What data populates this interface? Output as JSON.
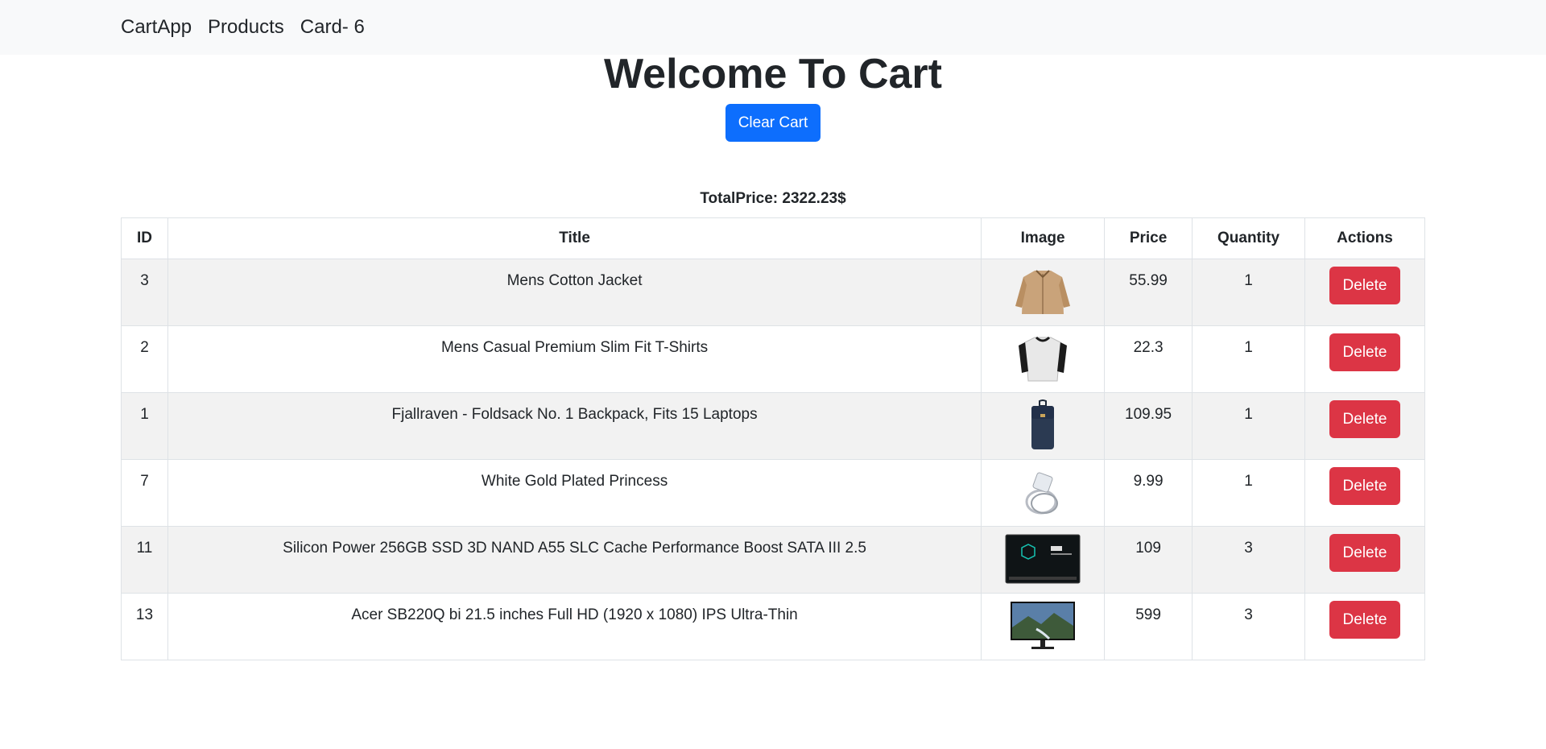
{
  "nav": {
    "brand": "CartApp",
    "products": "Products",
    "card": "Card- 6"
  },
  "main": {
    "title": "Welcome To Cart",
    "clear_button": "Clear Cart",
    "total_text": "TotalPrice: 2322.23$"
  },
  "table": {
    "headers": {
      "id": "ID",
      "title": "Title",
      "image": "Image",
      "price": "Price",
      "quantity": "Quantity",
      "actions": "Actions"
    },
    "rows": [
      {
        "id": "3",
        "title": "Mens Cotton Jacket",
        "image": "jacket-image",
        "price": "55.99",
        "quantity": "1",
        "action": "Delete"
      },
      {
        "id": "2",
        "title": "Mens Casual Premium Slim Fit T-Shirts",
        "image": "tshirt-image",
        "price": "22.3",
        "quantity": "1",
        "action": "Delete"
      },
      {
        "id": "1",
        "title": "Fjallraven - Foldsack No. 1 Backpack, Fits 15 Laptops",
        "image": "backpack-image",
        "price": "109.95",
        "quantity": "1",
        "action": "Delete"
      },
      {
        "id": "7",
        "title": "White Gold Plated Princess",
        "image": "ring-image",
        "price": "9.99",
        "quantity": "1",
        "action": "Delete"
      },
      {
        "id": "11",
        "title": "Silicon Power 256GB SSD 3D NAND A55 SLC Cache Performance Boost SATA III 2.5",
        "image": "ssd-image",
        "price": "109",
        "quantity": "3",
        "action": "Delete"
      },
      {
        "id": "13",
        "title": "Acer SB220Q bi 21.5 inches Full HD (1920 x 1080) IPS Ultra-Thin",
        "image": "monitor-image",
        "price": "599",
        "quantity": "3",
        "action": "Delete"
      }
    ]
  },
  "colors": {
    "navbar_bg": "#f8f9fa",
    "primary": "#0d6efd",
    "danger": "#dc3545",
    "stripe": "#f2f2f2"
  }
}
